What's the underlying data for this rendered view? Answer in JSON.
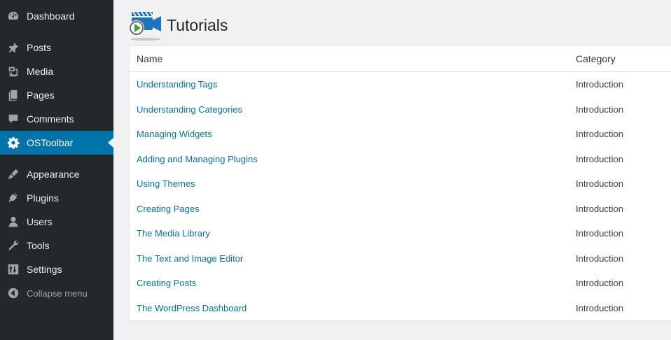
{
  "sidebar": {
    "items": [
      {
        "label": "Dashboard",
        "icon": "dashboard-icon"
      },
      {
        "label": "Posts",
        "icon": "pushpin-icon"
      },
      {
        "label": "Media",
        "icon": "media-icon"
      },
      {
        "label": "Pages",
        "icon": "pages-icon"
      },
      {
        "label": "Comments",
        "icon": "comment-icon"
      },
      {
        "label": "OSToolbar",
        "icon": "gear-icon",
        "active": true
      },
      {
        "label": "Appearance",
        "icon": "paintbrush-icon"
      },
      {
        "label": "Plugins",
        "icon": "plugin-icon"
      },
      {
        "label": "Users",
        "icon": "user-icon"
      },
      {
        "label": "Tools",
        "icon": "wrench-icon"
      },
      {
        "label": "Settings",
        "icon": "settings-icon"
      }
    ],
    "collapse_label": "Collapse menu"
  },
  "page": {
    "title": "Tutorials",
    "logo_icon": "video-tutorial-icon"
  },
  "table": {
    "headers": {
      "name": "Name",
      "category": "Category"
    },
    "rows": [
      {
        "name": "Understanding Tags",
        "category": "Introduction"
      },
      {
        "name": "Understanding Categories",
        "category": "Introduction"
      },
      {
        "name": "Managing Widgets",
        "category": "Introduction"
      },
      {
        "name": "Adding and Managing Plugins",
        "category": "Introduction"
      },
      {
        "name": "Using Themes",
        "category": "Introduction"
      },
      {
        "name": "Creating Pages",
        "category": "Introduction"
      },
      {
        "name": "The Media Library",
        "category": "Introduction"
      },
      {
        "name": "The Text and Image Editor",
        "category": "Introduction"
      },
      {
        "name": "Creating Posts",
        "category": "Introduction"
      },
      {
        "name": "The WordPress Dashboard",
        "category": "Introduction"
      }
    ]
  },
  "colors": {
    "sidebar_bg": "#23282d",
    "active_bg": "#0073aa",
    "link": "#0073aa",
    "page_bg": "#f1f1f1"
  }
}
